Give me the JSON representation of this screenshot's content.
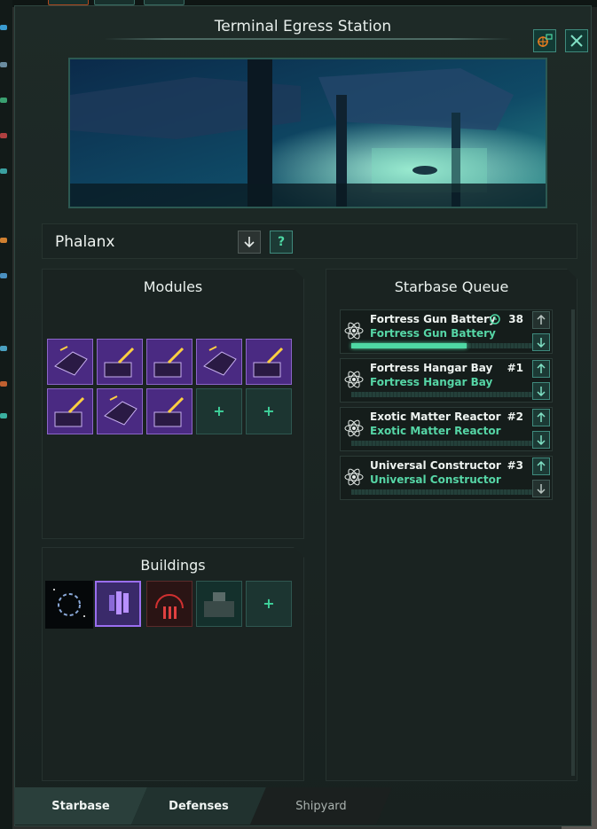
{
  "window": {
    "title": "Terminal Egress Station",
    "camera_icon": "camera-target-icon",
    "close_icon": "close-icon"
  },
  "starbase": {
    "name": "Phalanx",
    "downgrade_icon": "arrow-down-icon",
    "help_label": "?"
  },
  "modules": {
    "title": "Modules",
    "slots": [
      {
        "type": "hangar",
        "icon": "hangar-module-icon"
      },
      {
        "type": "gun",
        "icon": "gun-battery-module-icon"
      },
      {
        "type": "gun",
        "icon": "gun-battery-module-icon"
      },
      {
        "type": "hangar",
        "icon": "hangar-module-icon"
      },
      {
        "type": "gun",
        "icon": "gun-battery-module-icon"
      },
      {
        "type": "gun",
        "icon": "gun-battery-module-icon"
      },
      {
        "type": "hangar",
        "icon": "hangar-module-icon"
      },
      {
        "type": "gun",
        "icon": "gun-battery-module-icon"
      },
      {
        "type": "empty",
        "label": "+"
      },
      {
        "type": "empty",
        "label": "+"
      }
    ]
  },
  "buildings": {
    "title": "Buildings",
    "slots": [
      {
        "icon": "exotic-matter-building-icon"
      },
      {
        "icon": "fleet-command-building-icon"
      },
      {
        "icon": "communications-array-building-icon"
      },
      {
        "icon": "constructor-yard-building-icon"
      },
      {
        "type": "empty",
        "label": "+"
      }
    ]
  },
  "queue": {
    "title": "Starbase Queue",
    "items": [
      {
        "name": "Fortress Gun Battery",
        "sub": "Fortress Gun Battery",
        "status": "38",
        "timer_icon": "clock-icon",
        "progress": 0.62
      },
      {
        "name": "Fortress Hangar Bay",
        "sub": "Fortress Hangar Bay",
        "status": "#1",
        "progress": 0
      },
      {
        "name": "Exotic Matter Reactor",
        "sub": "Exotic Matter Reactor",
        "status": "#2",
        "progress": 0
      },
      {
        "name": "Universal Constructor",
        "sub": "Universal Constructor",
        "status": "#3",
        "progress": 0
      }
    ]
  },
  "tabs": [
    {
      "label": "Starbase",
      "active": true
    },
    {
      "label": "Defenses",
      "active": false
    },
    {
      "label": "Shipyard",
      "active": false
    }
  ],
  "colors": {
    "accent": "#4ed8a4",
    "module_purple": "#4a2a82",
    "panel": "#1a2321"
  }
}
